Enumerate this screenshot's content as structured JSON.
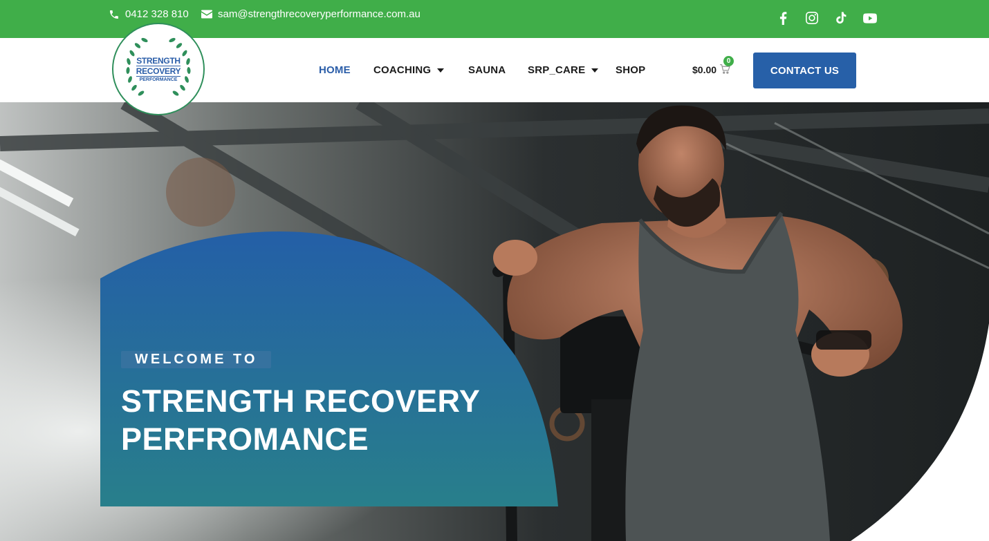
{
  "topbar": {
    "phone": "0412 328 810",
    "email": "sam@strengthrecoveryperformance.com.au",
    "socials": [
      "facebook-icon",
      "instagram-icon",
      "tiktok-icon",
      "youtube-icon"
    ]
  },
  "logo": {
    "line1": "STRENGTH",
    "line2": "RECOVERY",
    "line3": "PERFORMANCE"
  },
  "nav": {
    "home": "HOME",
    "coaching": "COACHING",
    "sauna": "SAUNA",
    "srp_care": "SRP_CARE",
    "shop": "SHOP"
  },
  "cart": {
    "total": "$0.00",
    "count": "0"
  },
  "header": {
    "contact_label": "CONTACT US"
  },
  "hero": {
    "kicker": "WELCOME TO",
    "title_line1": "STRENGTH RECOVERY",
    "title_line2": "PERFROMANCE"
  },
  "colors": {
    "green": "#40ae49",
    "blue": "#2760a8",
    "teal": "#277e8c"
  }
}
